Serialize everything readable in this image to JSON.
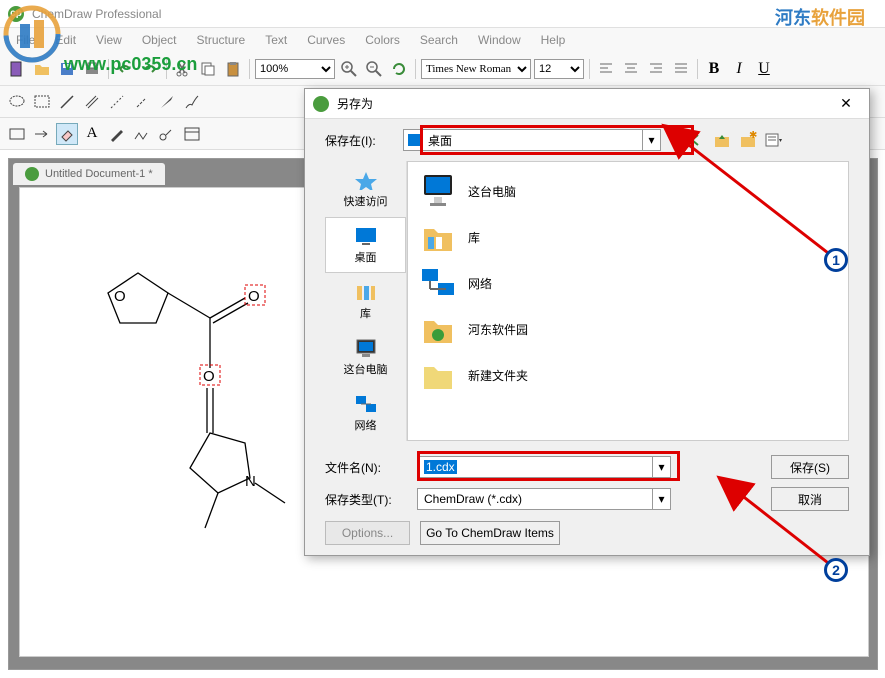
{
  "app": {
    "title": "ChemDraw Professional"
  },
  "menus": [
    "File",
    "Edit",
    "View",
    "Object",
    "Structure",
    "Text",
    "Curves",
    "Colors",
    "Search",
    "Window",
    "Help"
  ],
  "toolbar": {
    "zoom": "100%",
    "font": "Times New Roman",
    "fontsize": "12"
  },
  "document": {
    "tab": "Untitled Document-1 *"
  },
  "dialog": {
    "title": "另存为",
    "save_in_label": "保存在(I):",
    "save_in_value": "桌面",
    "sidebar": [
      {
        "label": "快速访问",
        "icon": "star"
      },
      {
        "label": "桌面",
        "icon": "desktop"
      },
      {
        "label": "库",
        "icon": "library"
      },
      {
        "label": "这台电脑",
        "icon": "computer"
      },
      {
        "label": "网络",
        "icon": "network"
      }
    ],
    "files": [
      {
        "name": "这台电脑",
        "icon": "monitor"
      },
      {
        "name": "库",
        "icon": "library-big"
      },
      {
        "name": "网络",
        "icon": "network-big"
      },
      {
        "name": "河东软件园",
        "icon": "folder-green"
      },
      {
        "name": "新建文件夹",
        "icon": "folder"
      }
    ],
    "filename_label": "文件名(N):",
    "filename_value": "1.cdx",
    "filetype_label": "保存类型(T):",
    "filetype_value": "ChemDraw (*.cdx)",
    "save_btn": "保存(S)",
    "cancel_btn": "取消",
    "options_btn": "Options...",
    "goto_btn": "Go To ChemDraw Items"
  },
  "annotations": {
    "num1": "1",
    "num2": "2"
  },
  "watermark": {
    "url": "www.pc0359.cn",
    "name_blue": "河东",
    "name_orange": "软件园"
  }
}
